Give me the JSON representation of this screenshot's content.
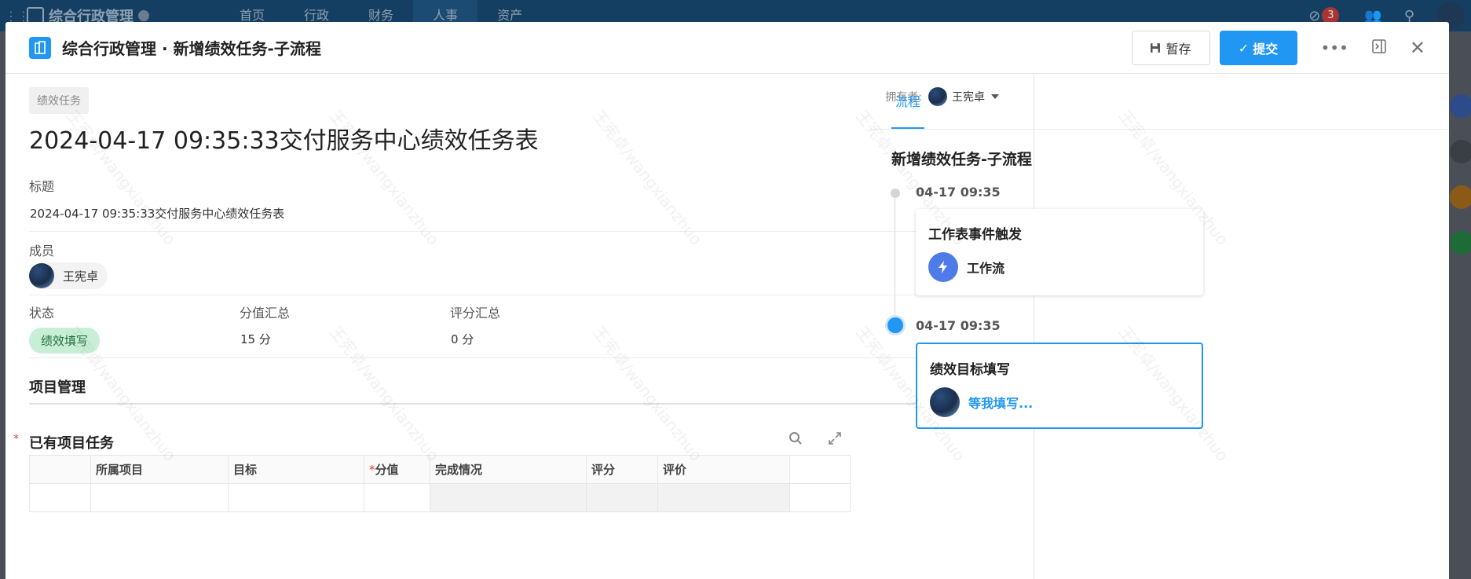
{
  "bg": {
    "app_name": "综合行政管理",
    "nav": [
      "首页",
      "行政",
      "财务",
      "人事",
      "资产"
    ],
    "active_nav": "人事",
    "badge": "3"
  },
  "header": {
    "title": "综合行政管理 · 新增绩效任务-子流程",
    "save_label": "暂存",
    "submit_label": "提交"
  },
  "record": {
    "tag": "绩效任务",
    "owner_label": "拥有者:",
    "owner_name": "王宪卓",
    "title": "2024-04-17 09:35:33交付服务中心绩效任务表",
    "fields": {
      "title_label": "标题",
      "title_value": "2024-04-17 09:35:33交付服务中心绩效任务表",
      "member_label": "成员",
      "member_name": "王宪卓",
      "status_label": "状态",
      "status_value": "绩效填写",
      "score_total_label": "分值汇总",
      "score_total_value": "15 分",
      "rating_total_label": "评分汇总",
      "rating_total_value": "0 分"
    },
    "section": "项目管理",
    "subsection": "已有项目任务",
    "table_headers": [
      "所属项目",
      "目标",
      "分值",
      "完成情况",
      "评分",
      "评价"
    ]
  },
  "side": {
    "tab": "流程",
    "flow_title": "新增绩效任务-子流程",
    "steps": [
      {
        "time": "04-17 09:35",
        "title": "工作表事件触发",
        "label": "工作流"
      },
      {
        "time": "04-17 09:35",
        "title": "绩效目标填写",
        "label": "等我填写..."
      }
    ]
  },
  "watermark": "王宪卓/wangxianzhuo",
  "colors": {
    "accent": "#2196f3",
    "status_bg": "#c8efd6",
    "topbar": "#143f63"
  }
}
